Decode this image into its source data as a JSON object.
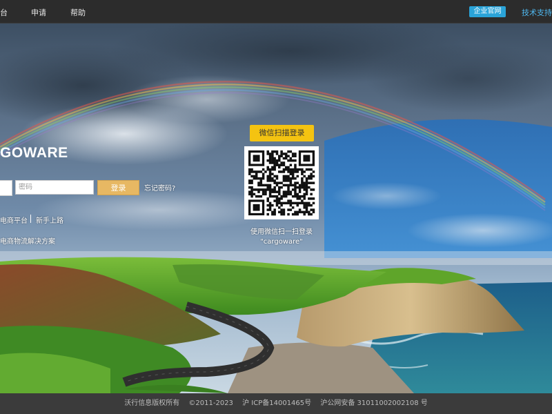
{
  "nav": {
    "items": [
      "台",
      "申请",
      "帮助"
    ],
    "company_site": "企业官网",
    "support": "技术支持"
  },
  "login": {
    "logo_text": "GOWARE",
    "password_placeholder": "密码",
    "login_button": "登录",
    "forgot_password": "忘记密码?",
    "link_platform": "电商平台",
    "link_newbie": "新手上路",
    "solution_text": "电商物流解决方案"
  },
  "qr": {
    "title": "微信扫描登录",
    "caption_line1": "使用微信扫一扫登录",
    "caption_line2": "\"cargoware\""
  },
  "footer": {
    "company": "沃行信息版权所有",
    "copyright": "©2011-2023",
    "icp": "沪 ICP备14001465号",
    "security": "沪公网安备 31011002002108 号"
  },
  "colors": {
    "topbar": "#2c2c2c",
    "badge": "#2aa3d8",
    "support_link": "#4fb8f0",
    "login_button": "#e7b863",
    "qr_title": "#f4c311",
    "footer": "#3b3b3b"
  }
}
